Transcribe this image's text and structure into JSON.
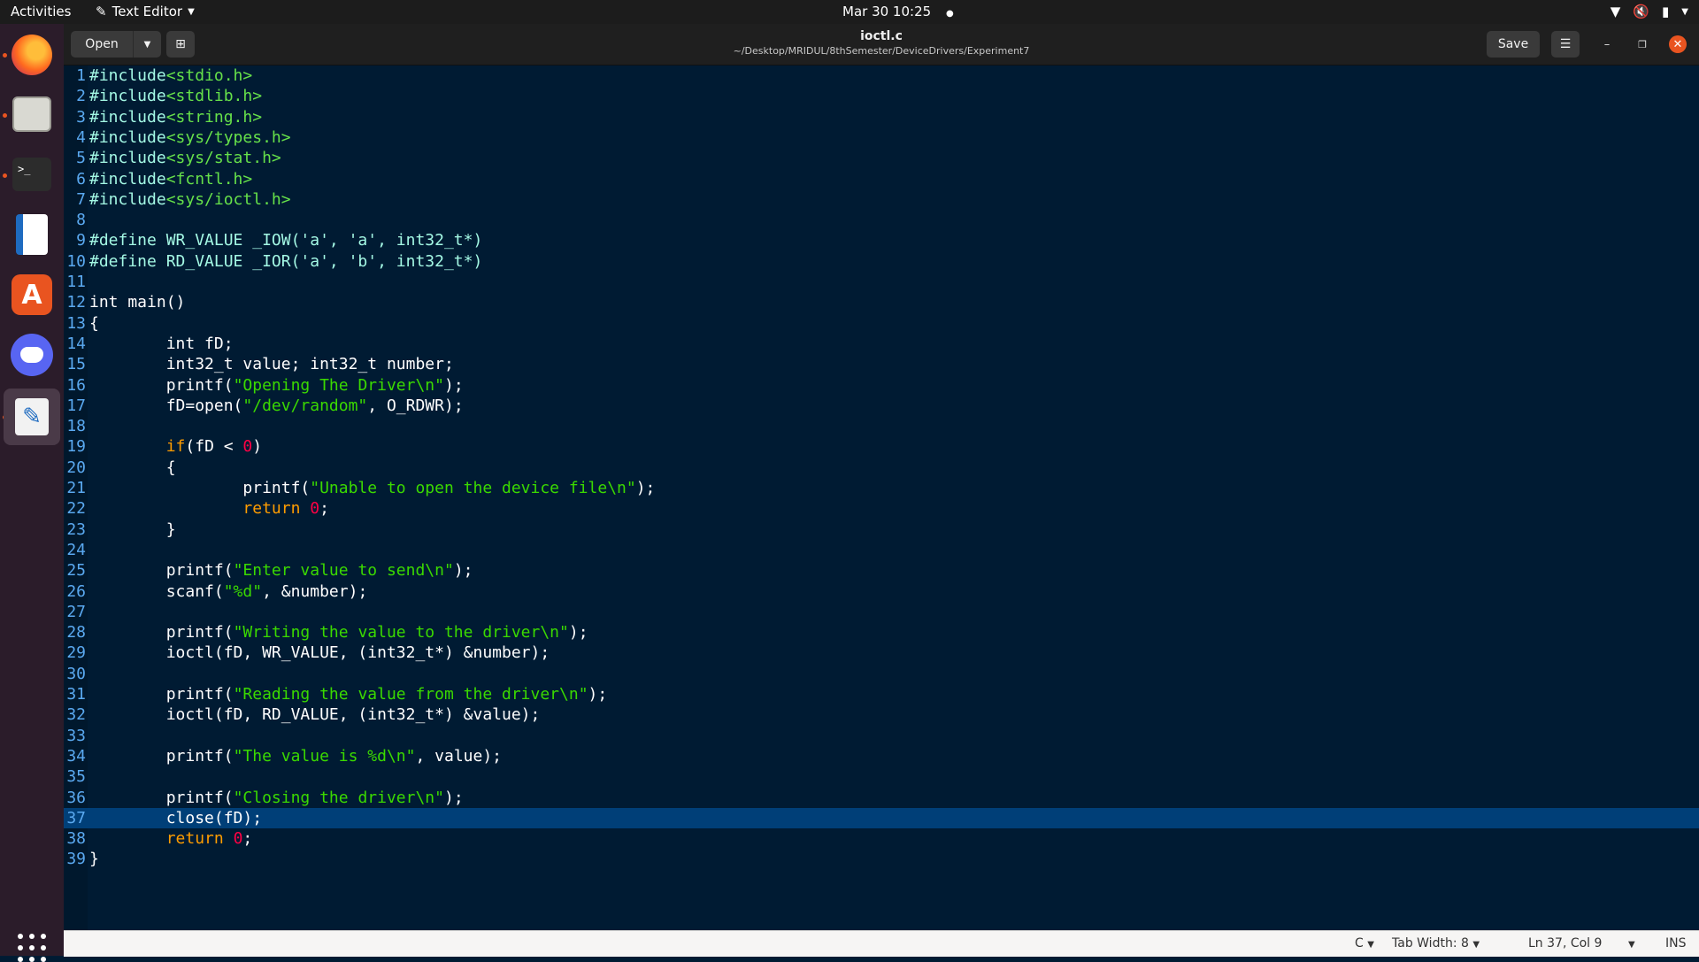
{
  "topbar": {
    "activities": "Activities",
    "app_name": "Text Editor",
    "clock": "Mar 30  10:25",
    "tray_icons": [
      "wifi-icon",
      "volume-muted-icon",
      "battery-icon",
      "system-menu-caret-icon"
    ]
  },
  "dock": {
    "apps": [
      "firefox",
      "files",
      "terminal",
      "libreoffice-writer",
      "ubuntu-software",
      "discord",
      "text-editor"
    ],
    "accent": "#e95420"
  },
  "header": {
    "open_label": "Open",
    "title": "ioctl.c",
    "subtitle": "~/Desktop/MRIDUL/8thSemester/DeviceDrivers/Experiment7",
    "save_label": "Save"
  },
  "editor": {
    "current_line": 37,
    "lines": [
      "#include<stdio.h>",
      "#include<stdlib.h>",
      "#include<string.h>",
      "#include<sys/types.h>",
      "#include<sys/stat.h>",
      "#include<fcntl.h>",
      "#include<sys/ioctl.h>",
      "",
      "#define WR_VALUE _IOW('a', 'a', int32_t*)",
      "#define RD_VALUE _IOR('a', 'b', int32_t*)",
      "",
      "int main()",
      "{",
      "\tint fD;",
      "\tint32_t value; int32_t number;",
      "\tprintf(\"Opening The Driver\\n\");",
      "\tfD=open(\"/dev/random\", O_RDWR);",
      "",
      "\tif(fD < 0)",
      "\t{",
      "\t\tprintf(\"Unable to open the device file\\n\");",
      "\t\treturn 0;",
      "\t}",
      "",
      "\tprintf(\"Enter value to send\\n\");",
      "\tscanf(\"%d\", &number);",
      "",
      "\tprintf(\"Writing the value to the driver\\n\");",
      "\tioctl(fD, WR_VALUE, (int32_t*) &number);",
      "",
      "\tprintf(\"Reading the value from the driver\\n\");",
      "\tioctl(fD, RD_VALUE, (int32_t*) &value);",
      "",
      "\tprintf(\"The value is %d\\n\", value);",
      "",
      "\tprintf(\"Closing the driver\\n\");",
      "\tclose(fD);",
      "\treturn 0;",
      "}"
    ]
  },
  "statusbar": {
    "language": "C",
    "tab_width": "Tab Width: 8",
    "cursor_position": "Ln 37, Col 9",
    "mode": "INS"
  }
}
